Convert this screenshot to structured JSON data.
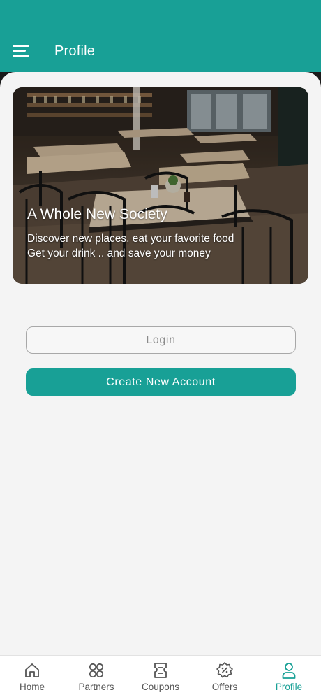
{
  "header": {
    "title": "Profile",
    "menu_icon": "hamburger-menu-icon"
  },
  "hero": {
    "image": "restaurant interior photo",
    "title": "A Whole New Society",
    "line1": "Discover new places, eat your favorite food",
    "line2": "Get your drink .. and save your money"
  },
  "auth": {
    "login_label": "Login",
    "create_label": "Create New Account"
  },
  "colors": {
    "accent": "#18a096",
    "background": "#f4f4f4"
  },
  "nav": {
    "active": "Profile",
    "items": [
      {
        "label": "Home",
        "icon": "home-icon"
      },
      {
        "label": "Partners",
        "icon": "grid-icon"
      },
      {
        "label": "Coupons",
        "icon": "ticket-icon"
      },
      {
        "label": "Offers",
        "icon": "discount-badge-icon"
      },
      {
        "label": "Profile",
        "icon": "user-icon"
      }
    ]
  }
}
